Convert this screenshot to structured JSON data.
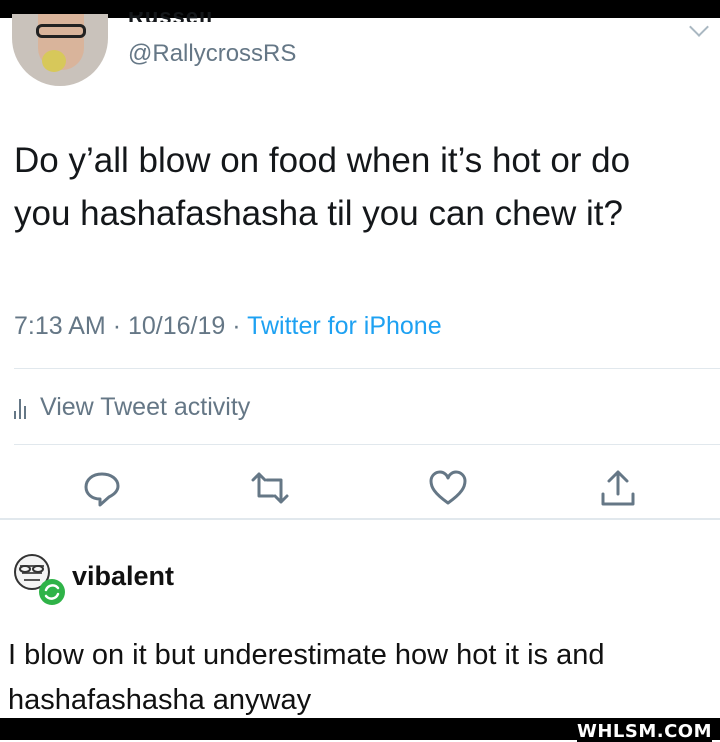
{
  "tweet": {
    "name_cut": "Russell",
    "handle": "@RallycrossRS",
    "text_line1": "Do y’all blow on food when it’s hot or do",
    "text_line2": "you hashafashasha til you can chew it?",
    "time": "7:13 AM",
    "date": "10/16/19",
    "source": "Twitter for iPhone",
    "activity_label": "View Tweet activity",
    "actions": [
      "reply-icon",
      "retweet-icon",
      "like-icon",
      "share-icon"
    ]
  },
  "reply": {
    "username": "vibalent",
    "text_line1": "I blow on it but underestimate how hot it is and",
    "text_line2": "hashafashasha anyway"
  },
  "watermark": "WHLSM.COM",
  "colors": {
    "text": "#14171a",
    "secondary": "#657786",
    "link": "#1da1f2",
    "divider": "#e1e8ed",
    "reblog_badge": "#2fb348"
  }
}
